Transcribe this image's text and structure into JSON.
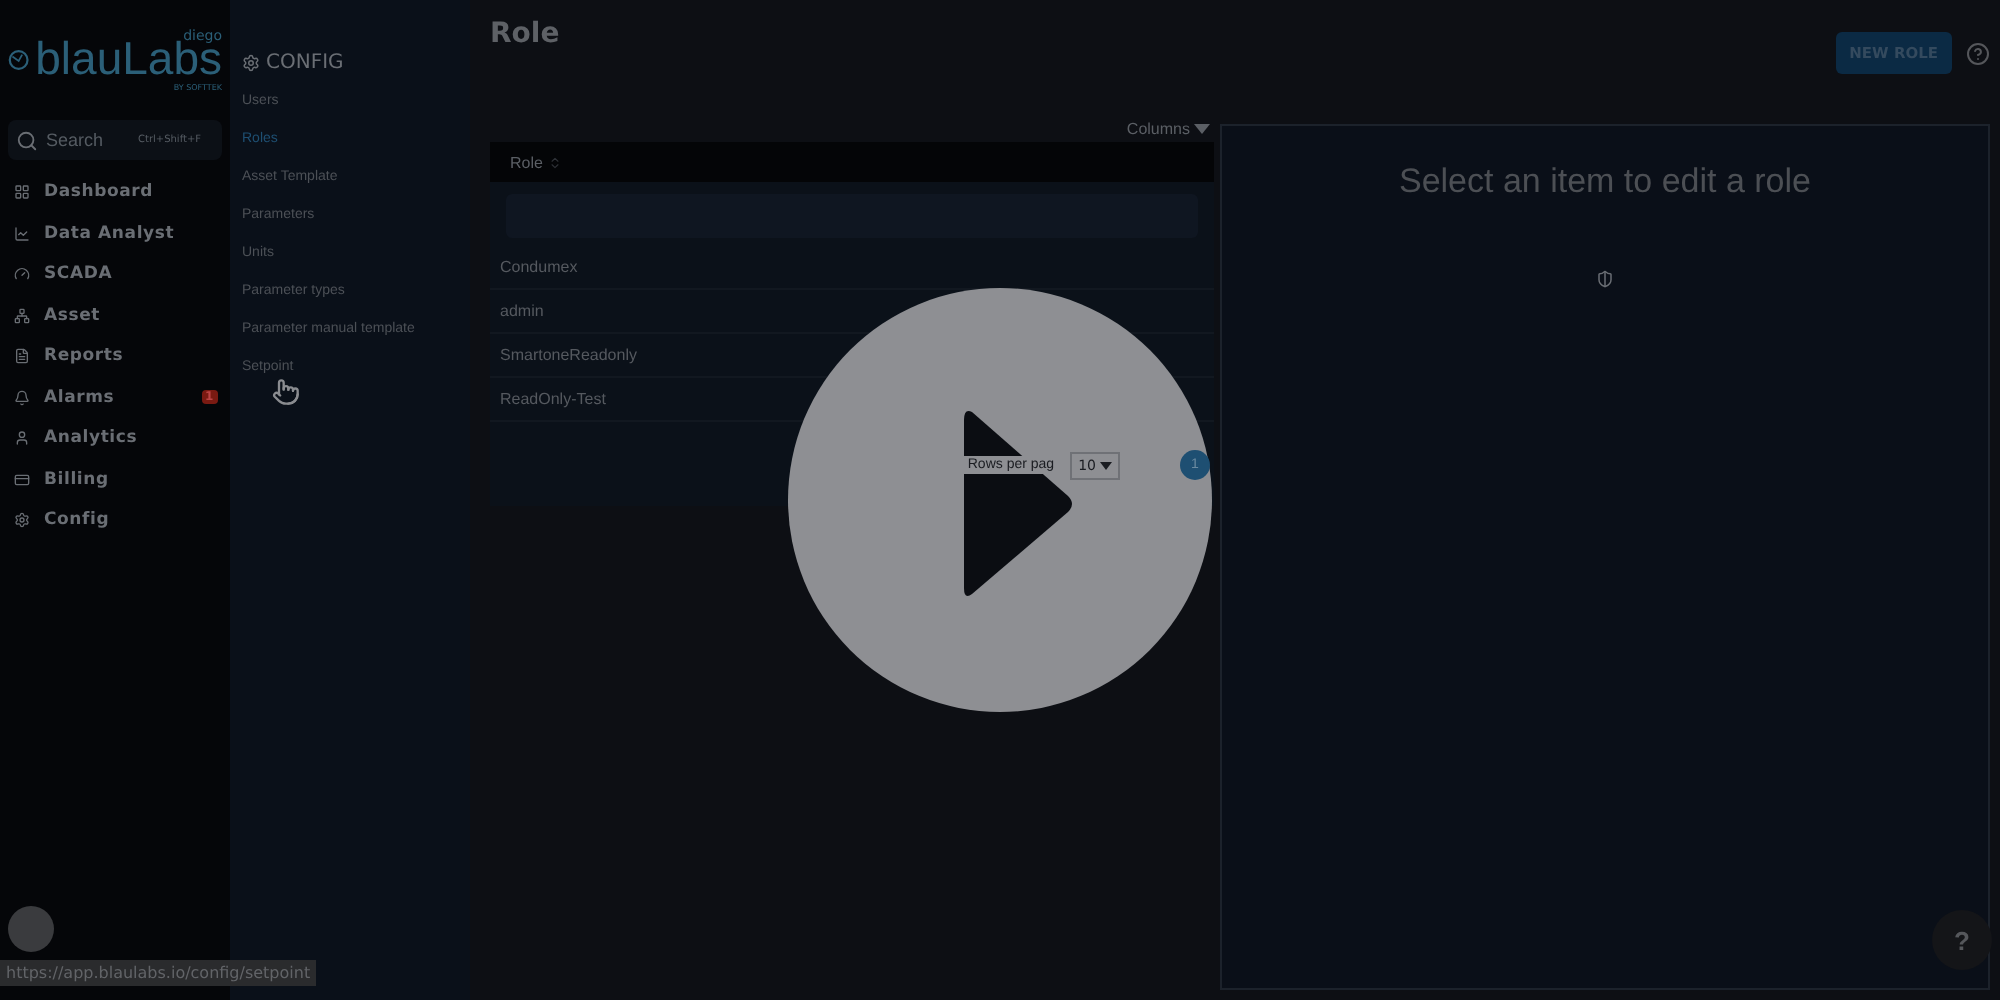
{
  "logo": {
    "superscript": "diego",
    "brand_prefix": "blau",
    "brand_suffix": "Labs",
    "tagline": "BY SOFTTEK"
  },
  "search": {
    "placeholder": "Search",
    "shortcut": "Ctrl+Shift+F"
  },
  "nav": [
    {
      "label": "Dashboard"
    },
    {
      "label": "Data Analyst"
    },
    {
      "label": "SCADA"
    },
    {
      "label": "Asset"
    },
    {
      "label": "Reports"
    },
    {
      "label": "Alarms",
      "badge": "1"
    },
    {
      "label": "Analytics"
    },
    {
      "label": "Billing"
    },
    {
      "label": "Config"
    }
  ],
  "config_menu": {
    "title": "CONFIG",
    "items": [
      {
        "label": "Users",
        "selected": false
      },
      {
        "label": "Roles",
        "selected": true
      },
      {
        "label": "Asset Template",
        "selected": false
      },
      {
        "label": "Parameters",
        "selected": false
      },
      {
        "label": "Units",
        "selected": false
      },
      {
        "label": "Parameter types",
        "selected": false
      },
      {
        "label": "Parameter manual template",
        "selected": false
      },
      {
        "label": "Setpoint",
        "selected": false
      }
    ]
  },
  "page": {
    "title": "Role",
    "new_button": "NEW ROLE"
  },
  "table": {
    "columns_button": "Columns",
    "columns": [
      "Role"
    ],
    "rows": [
      "Condumex",
      "admin",
      "SmartoneReadonly",
      "ReadOnly-Test"
    ],
    "pagination": {
      "rows_per_page_label": "Rows per pag",
      "page_size": "10",
      "current_page": "1"
    }
  },
  "editor": {
    "message": "Select an item to edit a role"
  },
  "status_url": "https://app.blaulabs.io/config/setpoint",
  "help_button": "?"
}
